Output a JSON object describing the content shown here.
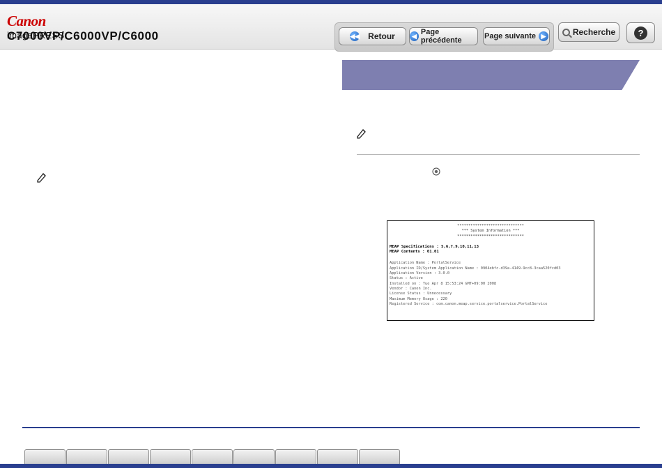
{
  "header": {
    "brand": "Canon",
    "product": "imagePRESS",
    "model": "C7000VP/C6000VP/C6000"
  },
  "nav": {
    "back": "Retour",
    "prev": "Page précédente",
    "next": "Page suivante",
    "search": "Recherche",
    "help": "?"
  },
  "doc": {
    "title_stars": "******************************",
    "title": "*** System Information ***",
    "spec_label": "MEAP Specifications : 5,6,7,9,10,11,13",
    "contents_label": "MEAP Contents : 01.01",
    "lines": [
      "Application Name : PortalService",
      "Application ID/System Application Name : 0904ebfc-d39a-4149-9cc8-3caa520fcd03",
      "Application Version : 3.0.0",
      "Status : Active",
      "Installed on : Tue Apr 8 15:53:24 GMT+09:00 2008",
      "Vendor : Canon Inc.",
      "License Status : Unnecessary",
      "Maximum Memory Usage : 220",
      "Registered Service : com.canon.meap.service.portalservice.PortalService"
    ]
  },
  "tabs": [
    "",
    "",
    "",
    "",
    "",
    "",
    "",
    "",
    ""
  ],
  "icons": {
    "note_left": "pencil-note-icon",
    "note_right": "pencil-note-icon",
    "settings": "settings-key-icon"
  },
  "colors": {
    "brand_red": "#cc0000",
    "bar_blue": "#2a3f8f",
    "banner": "#7e7fb0"
  }
}
